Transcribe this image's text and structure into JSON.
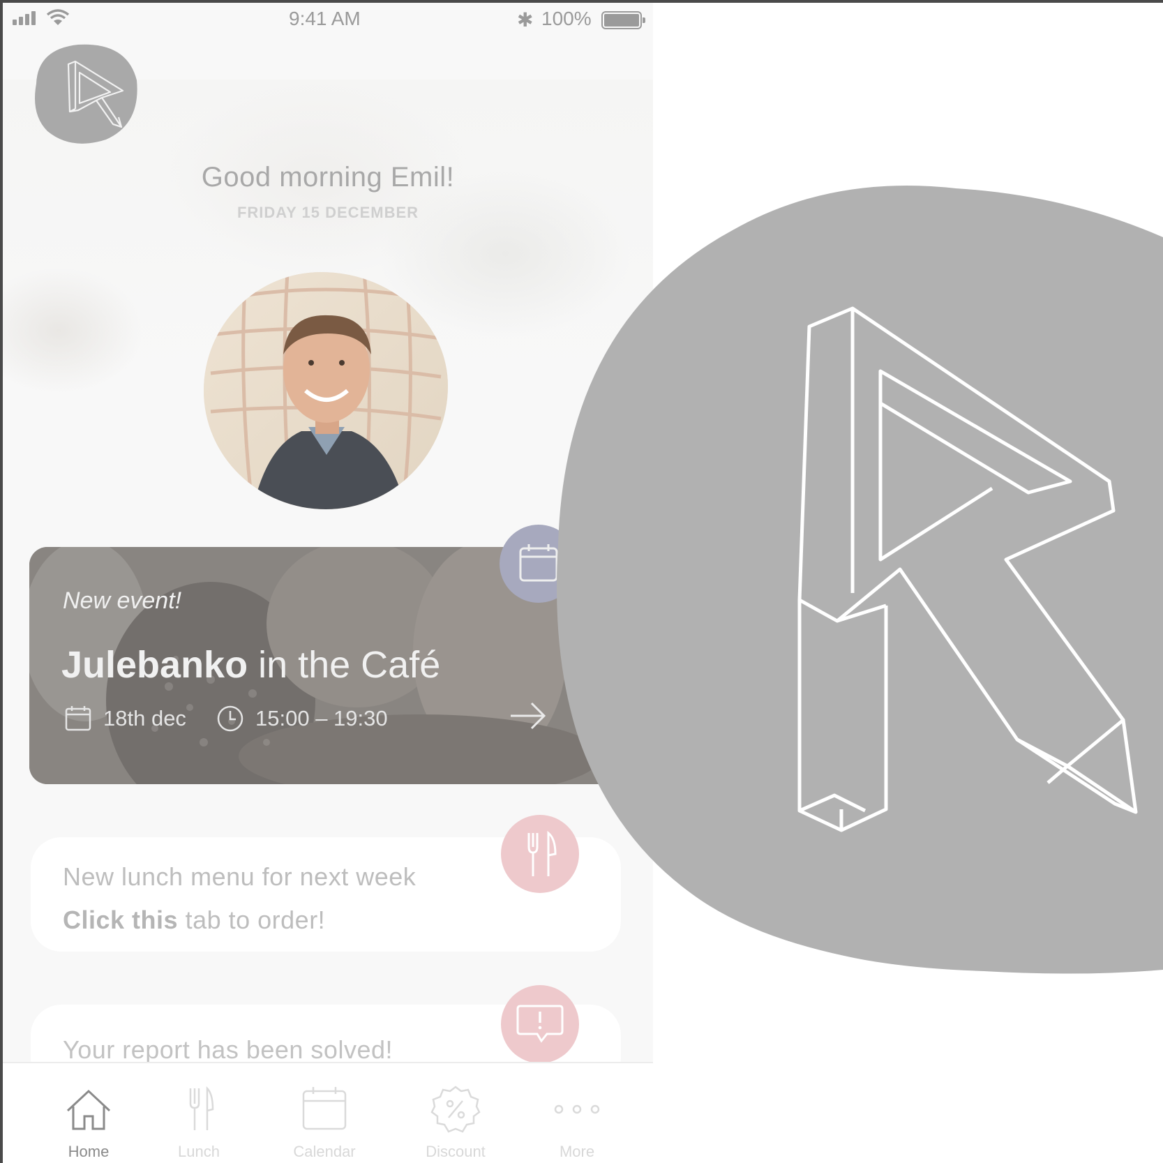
{
  "status_bar": {
    "time": "9:41 AM",
    "battery_percent": "100%",
    "icons": [
      "signal-icon",
      "wifi-icon",
      "bluetooth-icon",
      "battery-icon"
    ]
  },
  "header": {
    "greeting": "Good morning Emil!",
    "date": "FRIDAY 15 DECEMBER"
  },
  "event": {
    "badge": "New event!",
    "title_bold": "Julebanko",
    "title_rest": " in the Café",
    "date": "18th dec",
    "time": "15:00 – 19:30",
    "icons": [
      "calendar-icon",
      "clock-icon",
      "arrow-right-icon"
    ]
  },
  "lunch_card": {
    "line1": "New lunch menu for next week",
    "line2_bold": "Click this",
    "line2_rest": " tab to order!",
    "icon": "cutlery-icon"
  },
  "report_card": {
    "text": "Your report has been solved!",
    "icon": "speech-bubble-alert-icon"
  },
  "tabs": [
    {
      "label": "Home",
      "icon": "home-icon",
      "active": true
    },
    {
      "label": "Lunch",
      "icon": "cutlery-icon",
      "active": false
    },
    {
      "label": "Calendar",
      "icon": "calendar-icon",
      "active": false
    },
    {
      "label": "Discount",
      "icon": "percent-icon",
      "active": false
    },
    {
      "label": "More",
      "icon": "more-dots-icon",
      "active": false
    }
  ],
  "colors": {
    "logo_gray": "#b1b1b1",
    "event_fab": "#a7a9be",
    "pink_fab": "#eec9cc",
    "muted_text": "#bdbdbd"
  }
}
